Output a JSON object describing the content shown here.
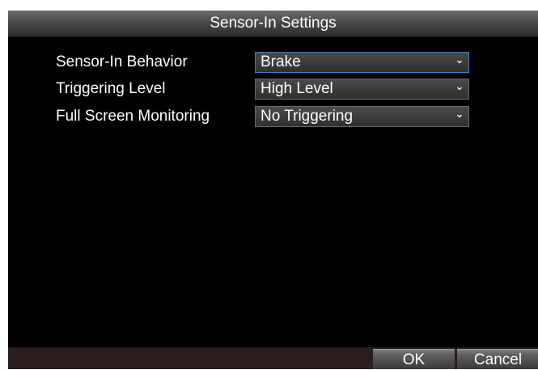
{
  "dialog": {
    "title": "Sensor-In Settings"
  },
  "fields": [
    {
      "label": "Sensor-In Behavior",
      "value": "Brake"
    },
    {
      "label": "Triggering Level",
      "value": "High Level"
    },
    {
      "label": "Full Screen Monitoring",
      "value": "No Triggering"
    }
  ],
  "buttons": {
    "ok": "OK",
    "cancel": "Cancel"
  },
  "icons": {
    "dropdown": "chevron-down-icon"
  },
  "colors": {
    "background": "#000000",
    "text": "#ffffff",
    "focus_border": "#2f7fdc",
    "footer": "#2a1e1e"
  }
}
